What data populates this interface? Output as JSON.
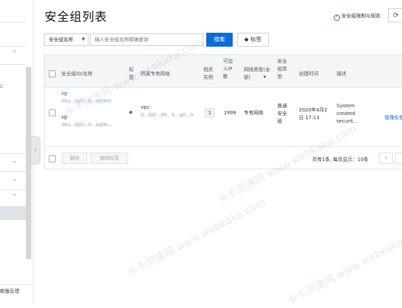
{
  "page": {
    "title": "安全组列表",
    "quota_link": "安全组限制与规则",
    "refresh_icon": "⟳"
  },
  "sidebar": {
    "fragment_letter": "c",
    "feedback_label": "新版反馈"
  },
  "search": {
    "field_select": "安全组名称",
    "placeholder": "输入安全组名称精确查询",
    "search_label": "搜索",
    "tag_label": "标签"
  },
  "table": {
    "headers": {
      "id_name": "安全组ID/名称",
      "tag": "标签",
      "vpc": "所属专有网络",
      "instances": "相关实例",
      "ip_quota": "可加入IP数",
      "network_type": "网络类型(全部)",
      "sg_type": "安全组类型",
      "created": "创建时间",
      "desc": "描述"
    },
    "rows": [
      {
        "id_prefix": "sg-",
        "id_masked": "0ku...0j0c..0...qq0b0",
        "name_prefix": "sg-",
        "name_masked": "0ku...0j0c..0...qq0s...",
        "vpc_prefix": "vpc-",
        "vpc_masked": "0...0j0...0h...0...g0...0",
        "instances": "1",
        "ip_quota": "1999",
        "network_type": "专有网络",
        "sg_type": "普通安全组",
        "created": "2020年4月2日 17:13",
        "desc": "System created securit...",
        "action": "管理实例"
      }
    ],
    "footer": {
      "delete_label": "删除",
      "edit_tags_label": "编辑标签",
      "page_info": "共有1条, 每页显示：10条",
      "prev_icon": "‹"
    }
  },
  "watermark": "卡卡测速网 www.webkaka.com",
  "colors": {
    "accent": "#0a6cd4",
    "header_bg": "#f4f5f6"
  }
}
